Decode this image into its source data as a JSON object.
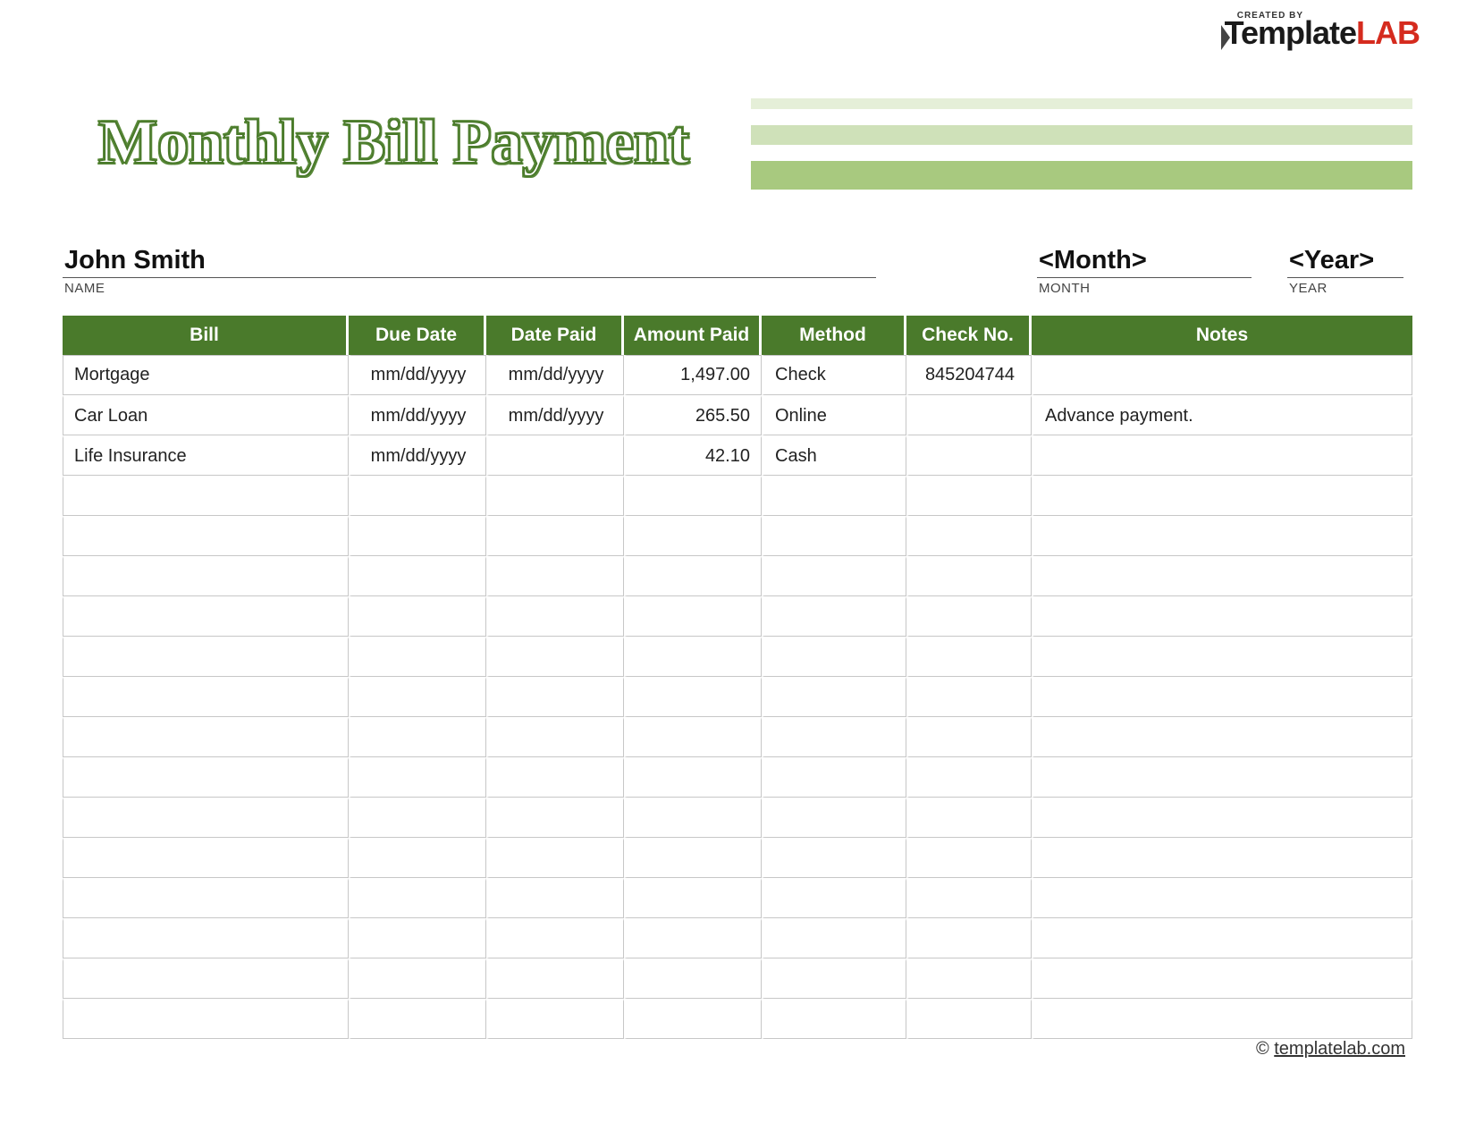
{
  "branding": {
    "created_by": "CREATED BY",
    "template_prefix": "Template",
    "template_suffix": "LAB"
  },
  "title": "Monthly Bill Payment",
  "fields": {
    "name_value": "John Smith",
    "name_label": "NAME",
    "month_value": "<Month>",
    "month_label": "MONTH",
    "year_value": "<Year>",
    "year_label": "YEAR"
  },
  "columns": {
    "bill": "Bill",
    "due_date": "Due Date",
    "date_paid": "Date Paid",
    "amount_paid": "Amount Paid",
    "method": "Method",
    "check_no": "Check No.",
    "notes": "Notes"
  },
  "rows": [
    {
      "bill": "Mortgage",
      "due": "mm/dd/yyyy",
      "paid": "mm/dd/yyyy",
      "amount": "1,497.00",
      "method": "Check",
      "check": "845204744",
      "notes": ""
    },
    {
      "bill": "Car Loan",
      "due": "mm/dd/yyyy",
      "paid": "mm/dd/yyyy",
      "amount": "265.50",
      "method": "Online",
      "check": "",
      "notes": "Advance payment."
    },
    {
      "bill": "Life Insurance",
      "due": "mm/dd/yyyy",
      "paid": "",
      "amount": "42.10",
      "method": "Cash",
      "check": "",
      "notes": ""
    },
    {
      "bill": "",
      "due": "",
      "paid": "",
      "amount": "",
      "method": "",
      "check": "",
      "notes": ""
    },
    {
      "bill": "",
      "due": "",
      "paid": "",
      "amount": "",
      "method": "",
      "check": "",
      "notes": ""
    },
    {
      "bill": "",
      "due": "",
      "paid": "",
      "amount": "",
      "method": "",
      "check": "",
      "notes": ""
    },
    {
      "bill": "",
      "due": "",
      "paid": "",
      "amount": "",
      "method": "",
      "check": "",
      "notes": ""
    },
    {
      "bill": "",
      "due": "",
      "paid": "",
      "amount": "",
      "method": "",
      "check": "",
      "notes": ""
    },
    {
      "bill": "",
      "due": "",
      "paid": "",
      "amount": "",
      "method": "",
      "check": "",
      "notes": ""
    },
    {
      "bill": "",
      "due": "",
      "paid": "",
      "amount": "",
      "method": "",
      "check": "",
      "notes": ""
    },
    {
      "bill": "",
      "due": "",
      "paid": "",
      "amount": "",
      "method": "",
      "check": "",
      "notes": ""
    },
    {
      "bill": "",
      "due": "",
      "paid": "",
      "amount": "",
      "method": "",
      "check": "",
      "notes": ""
    },
    {
      "bill": "",
      "due": "",
      "paid": "",
      "amount": "",
      "method": "",
      "check": "",
      "notes": ""
    },
    {
      "bill": "",
      "due": "",
      "paid": "",
      "amount": "",
      "method": "",
      "check": "",
      "notes": ""
    },
    {
      "bill": "",
      "due": "",
      "paid": "",
      "amount": "",
      "method": "",
      "check": "",
      "notes": ""
    },
    {
      "bill": "",
      "due": "",
      "paid": "",
      "amount": "",
      "method": "",
      "check": "",
      "notes": ""
    },
    {
      "bill": "",
      "due": "",
      "paid": "",
      "amount": "",
      "method": "",
      "check": "",
      "notes": ""
    }
  ],
  "footer": {
    "copyright": "© ",
    "link_text": "templatelab.com"
  }
}
